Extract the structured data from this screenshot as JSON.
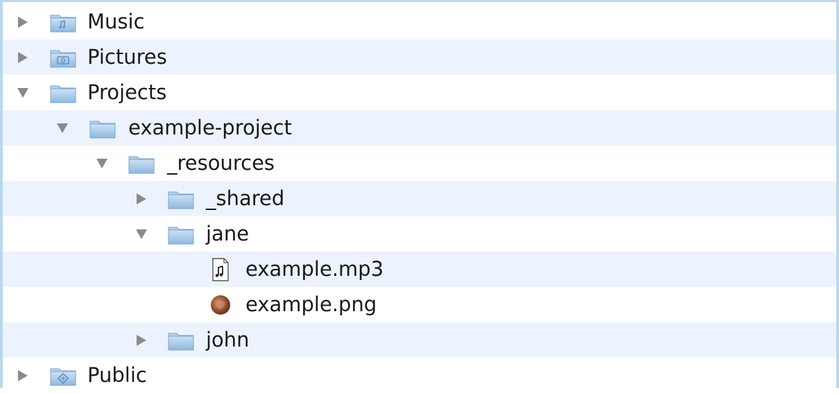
{
  "tree": {
    "items": [
      {
        "label": "Music",
        "icon": "music-folder-icon",
        "expanded": false
      },
      {
        "label": "Pictures",
        "icon": "pictures-folder-icon",
        "expanded": false
      },
      {
        "label": "Projects",
        "icon": "folder-icon",
        "expanded": true
      },
      {
        "label": "example-project",
        "icon": "folder-icon",
        "expanded": true
      },
      {
        "label": "_resources",
        "icon": "folder-icon",
        "expanded": true
      },
      {
        "label": "_shared",
        "icon": "folder-icon",
        "expanded": false
      },
      {
        "label": "jane",
        "icon": "folder-icon",
        "expanded": true
      },
      {
        "label": "example.mp3",
        "icon": "audio-file-icon"
      },
      {
        "label": "example.png",
        "icon": "image-file-icon"
      },
      {
        "label": "john",
        "icon": "folder-icon",
        "expanded": false
      },
      {
        "label": "Public",
        "icon": "public-folder-icon",
        "expanded": false
      }
    ]
  },
  "colors": {
    "stripe": "#edf3fe",
    "window_border": "#b9d8ef",
    "folder": "#9fc3e6",
    "disclosure": "#8a8a8a"
  }
}
